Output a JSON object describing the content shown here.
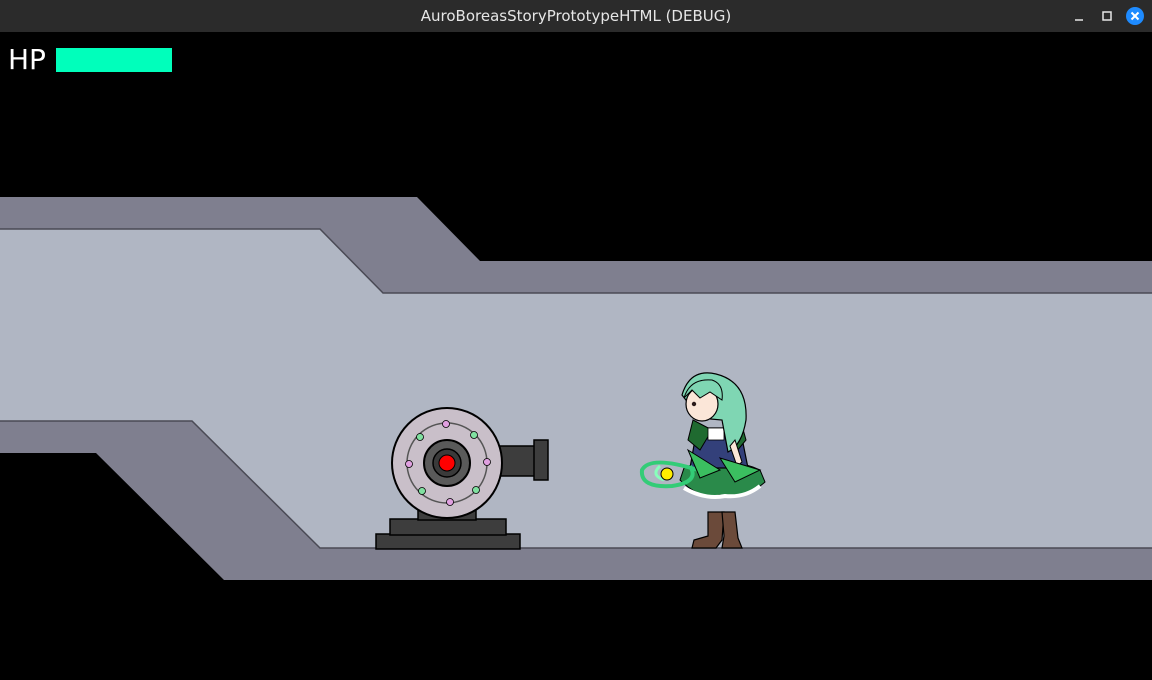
{
  "window": {
    "title": "AuroBoreasStoryPrototypeHTML (DEBUG)",
    "minimize_icon": "minimize-icon",
    "maximize_icon": "maximize-icon",
    "close_icon": "close-icon",
    "close_color": "#1e8bff"
  },
  "hud": {
    "hp_label": "HP",
    "hp_fraction": 1.0,
    "hp_color": "#00ffbb"
  },
  "scene": {
    "wall_color": "#7f7f8f",
    "floor_color": "#b0b6c3",
    "turret_icon": "cannon-turret",
    "player_icon": "green-haired-girl-character"
  }
}
